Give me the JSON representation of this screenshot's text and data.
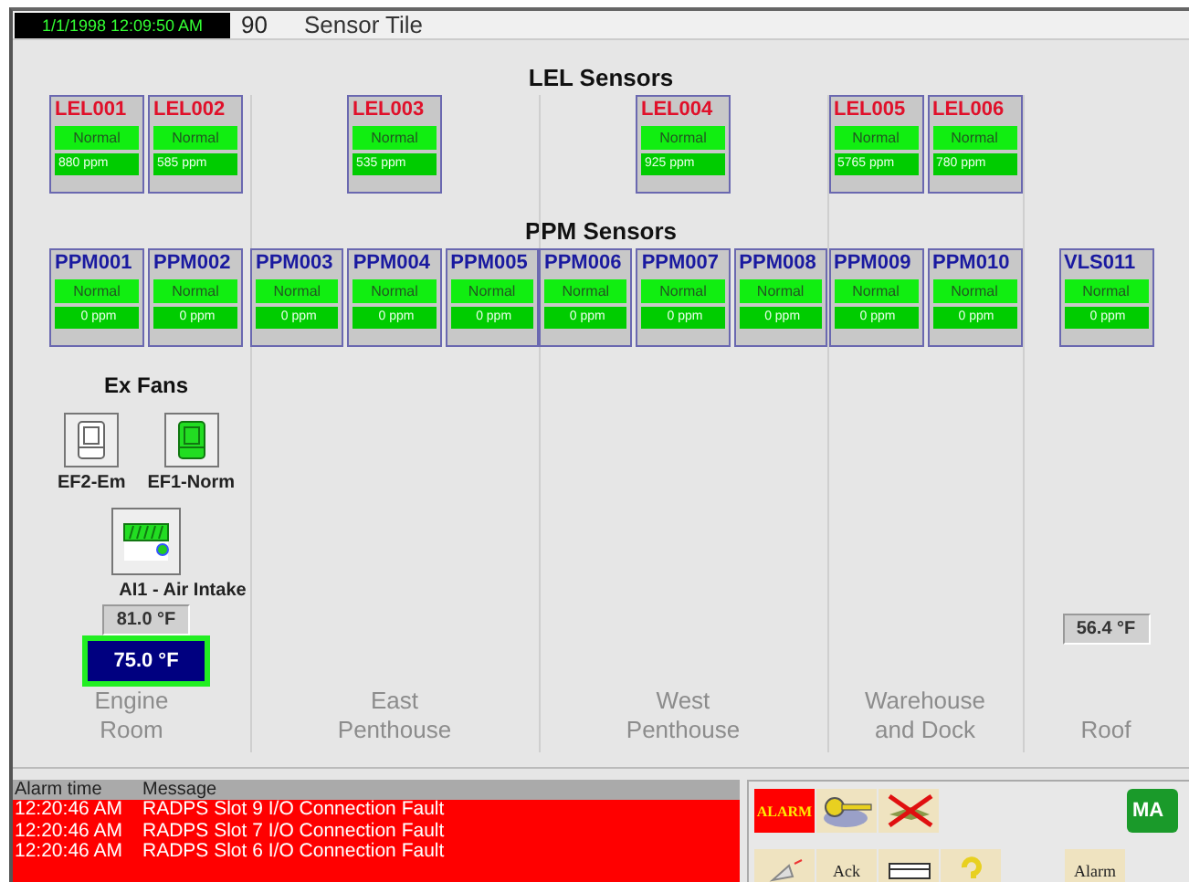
{
  "header": {
    "clock": "1/1/1998 12:09:50 AM",
    "number": "90",
    "title": "Sensor Tile"
  },
  "lel_title": "LEL Sensors",
  "ppm_title": "PPM Sensors",
  "areas": [
    {
      "name": "Engine Room",
      "lel": [
        {
          "id": "LEL001",
          "status": "Normal",
          "reading": "880 ppm"
        },
        {
          "id": "LEL002",
          "status": "Normal",
          "reading": "585 ppm"
        }
      ],
      "ppm": [
        {
          "id": "PPM001",
          "status": "Normal",
          "reading": "0 ppm"
        },
        {
          "id": "PPM002",
          "status": "Normal",
          "reading": "0 ppm"
        }
      ],
      "fans_title": "Ex Fans",
      "fans": [
        {
          "label": "EF2-Em",
          "running": false
        },
        {
          "label": "EF1-Norm",
          "running": true
        }
      ],
      "intake": {
        "label": "AI1 - Air Intake"
      },
      "temps": [
        {
          "kind": "reading",
          "value": "81.0 °F"
        },
        {
          "kind": "setpoint",
          "value": "75.0 °F"
        }
      ]
    },
    {
      "name": "East Penthouse",
      "lel": [
        {
          "id": "LEL003",
          "status": "Normal",
          "reading": "535 ppm"
        }
      ],
      "ppm": [
        {
          "id": "PPM003",
          "status": "Normal",
          "reading": "0 ppm"
        },
        {
          "id": "PPM004",
          "status": "Normal",
          "reading": "0 ppm"
        },
        {
          "id": "PPM005",
          "status": "Normal",
          "reading": "0 ppm"
        }
      ]
    },
    {
      "name": "West Penthouse",
      "lel": [
        {
          "id": "LEL004",
          "status": "Normal",
          "reading": "925 ppm"
        }
      ],
      "ppm": [
        {
          "id": "PPM006",
          "status": "Normal",
          "reading": "0 ppm"
        },
        {
          "id": "PPM007",
          "status": "Normal",
          "reading": "0 ppm"
        },
        {
          "id": "PPM008",
          "status": "Normal",
          "reading": "0 ppm"
        }
      ]
    },
    {
      "name": "Warehouse and Dock",
      "lel": [
        {
          "id": "LEL005",
          "status": "Normal",
          "reading": "5765 ppm"
        },
        {
          "id": "LEL006",
          "status": "Normal",
          "reading": "780 ppm"
        }
      ],
      "ppm": [
        {
          "id": "PPM009",
          "status": "Normal",
          "reading": "0 ppm"
        },
        {
          "id": "PPM010",
          "status": "Normal",
          "reading": "0 ppm"
        }
      ]
    },
    {
      "name": "Roof",
      "ppm": [
        {
          "id": "VLS011",
          "status": "Normal",
          "reading": "0 ppm"
        }
      ],
      "temps": [
        {
          "kind": "reading",
          "value": "56.4 °F"
        }
      ]
    }
  ],
  "alarms": {
    "columns": [
      "Alarm time",
      "Message"
    ],
    "rows": [
      {
        "time": "12:20:46 AM",
        "message": "RADPS Slot 9 I/O Connection Fault"
      },
      {
        "time": "12:20:46 AM",
        "message": "RADPS Slot 7 I/O Connection Fault"
      },
      {
        "time": "12:20:46 AM",
        "message": "RADPS Slot 6 I/O Connection Fault"
      }
    ]
  },
  "toolbar": [
    [
      {
        "kind": "alarm",
        "label": "ALARM"
      },
      {
        "kind": "key"
      },
      {
        "kind": "silence"
      },
      {
        "kind": "map",
        "label": "MA"
      }
    ],
    [
      {
        "kind": "horn"
      },
      {
        "kind": "ack",
        "label": "Ack"
      },
      {
        "kind": "list"
      },
      {
        "kind": "help"
      },
      {
        "kind": "alarm-list",
        "label": "Alarm"
      }
    ]
  ]
}
